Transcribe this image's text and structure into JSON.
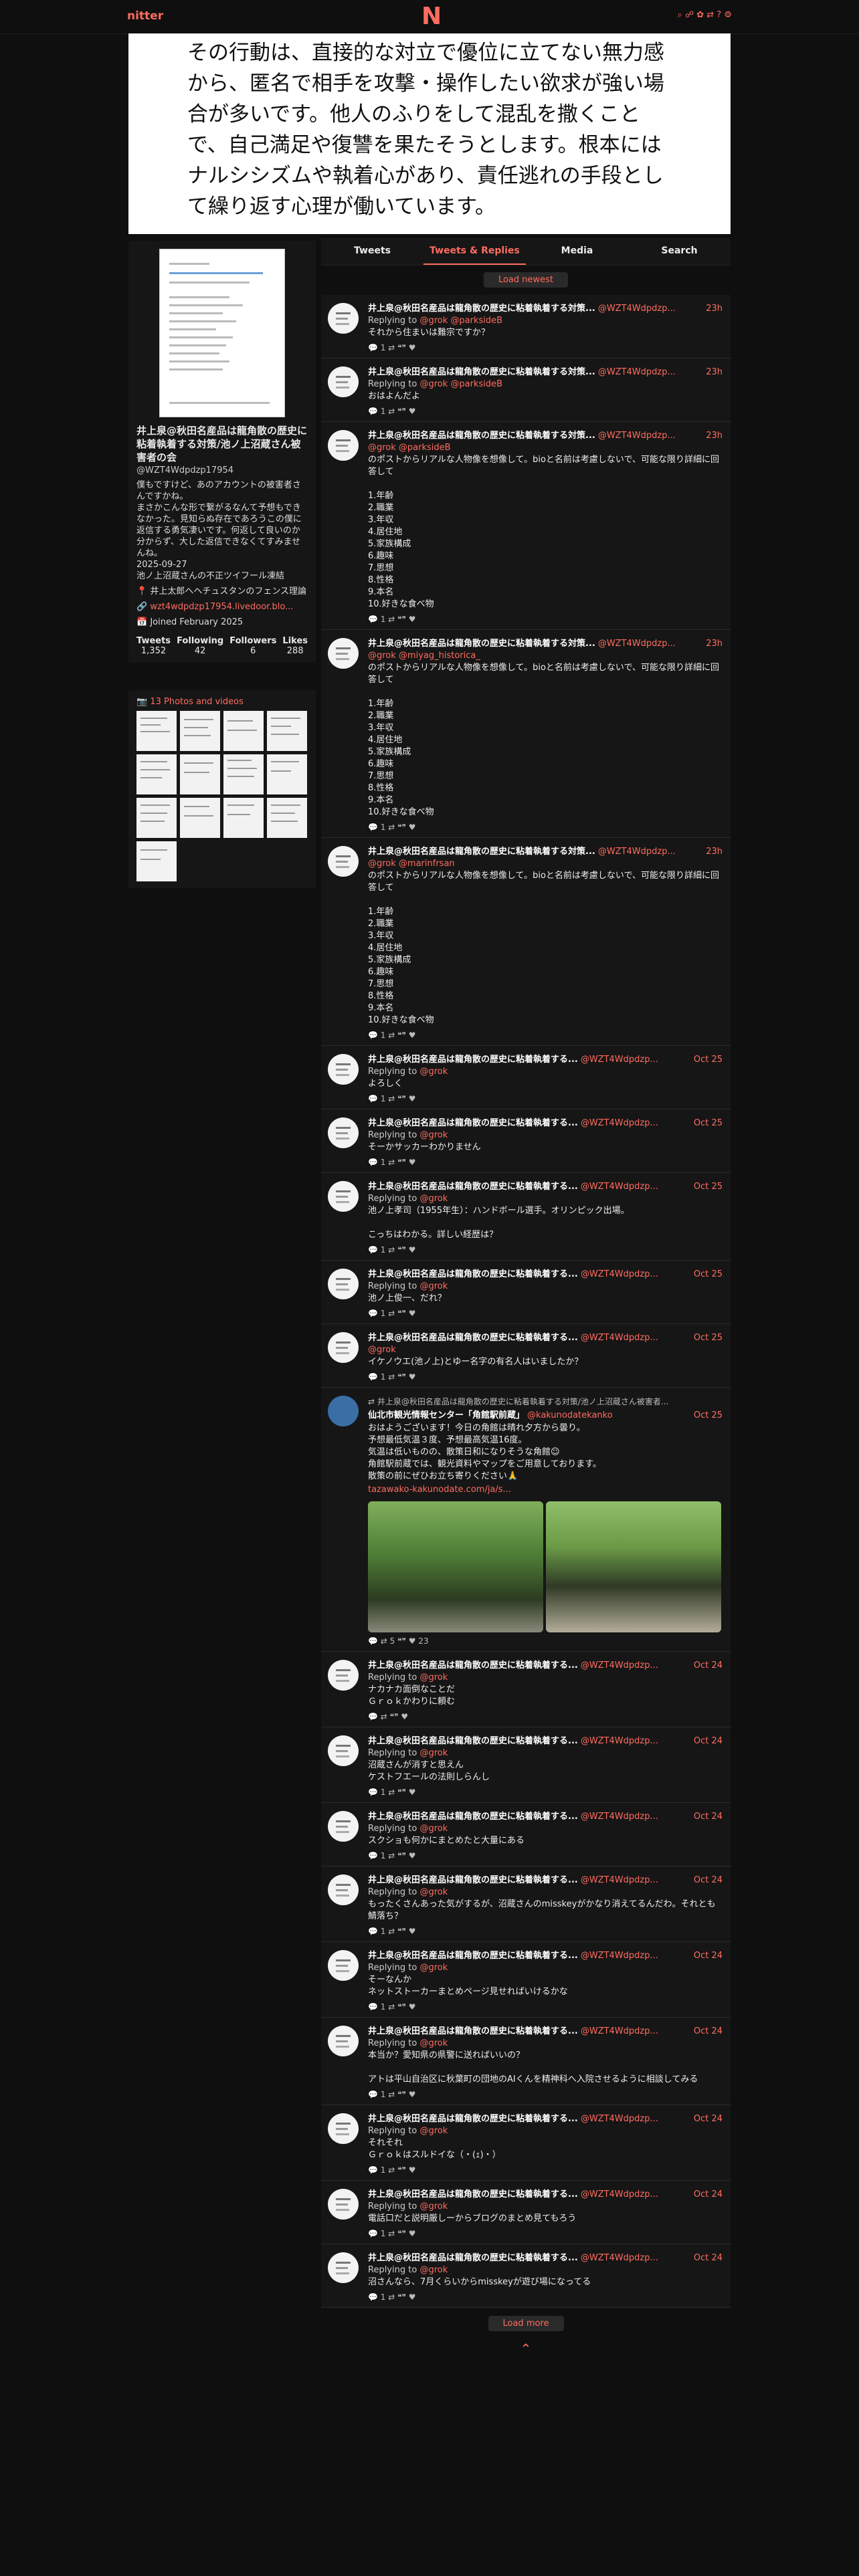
{
  "nav": {
    "brand": "nitter",
    "logo": "N",
    "icons": "⌕ ☍ ✿ ⇄ ? ⚙"
  },
  "hero": {
    "text": "その行動は、直接的な対立で優位に立てない無力感から、匿名で相手を攻撃・操作したい欲求が強い場合が多いです。他人のふりをして混乱を撒くことで、自己満足や復讐を果たそうとします。根本にはナルシシズムや執着心があり、責任逃れの手段として繰り返す心理が働いています。"
  },
  "profile": {
    "name": "井上泉@秋田名産品は龍角散の歴史に粘着執着する対策/池ノ上沼蔵さん被害者の会",
    "handle": "@WZT4Wdpdzp17954",
    "bio": "僕もですけど、あのアカウントの被害者さんですかね。\nまさかこんな形で繋がるなんて予想もできなかった。見知らぬ存在であろうこの僕に返信する勇気凄いです。何返して良いのか分からず、大した返信できなくてすみませんね。\n2025-09-27\n池ノ上沼蔵さんの不正ツイフール凍結",
    "location": "📍 井上太郎ヘヘチュスタンのフェンス理論",
    "website": "🔗 wzt4wdpdzp17954.livedoor.blo...",
    "joined": "📅 Joined February 2025",
    "stats": [
      {
        "label": "Tweets",
        "value": "1,352"
      },
      {
        "label": "Following",
        "value": "42"
      },
      {
        "label": "Followers",
        "value": "6"
      },
      {
        "label": "Likes",
        "value": "288"
      }
    ]
  },
  "photos": {
    "label": "📷 13 Photos and videos"
  },
  "tabs": [
    "Tweets",
    "Tweets & Replies",
    "Media",
    "Search"
  ],
  "load_newest": "Load newest",
  "load_more": "Load more",
  "tweets": [
    {
      "name": "井上泉@秋田名産品は龍角散の歴史に粘着執着する対策...",
      "handle": "@WZT4Wdpdzp...",
      "time": "23h",
      "reply": "Replying to ",
      "mentions": "@grok @parksideB",
      "text": "それから住まいは難宗ですか？",
      "acts": "💬 1   ⇄   ❝❞   ♥"
    },
    {
      "name": "井上泉@秋田名産品は龍角散の歴史に粘着執着する対策...",
      "handle": "@WZT4Wdpdzp...",
      "time": "23h",
      "reply": "Replying to ",
      "mentions": "@grok @parksideB",
      "text": "おはよんだよ",
      "acts": "💬 1   ⇄   ❝❞   ♥"
    },
    {
      "name": "井上泉@秋田名産品は龍角散の歴史に粘着執着する対策...",
      "handle": "@WZT4Wdpdzp...",
      "time": "23h",
      "reply": "",
      "mentions": "@grok @parksideB",
      "text": "のポストからリアルな人物像を想像して。bioと名前は考慮しないで、可能な限り詳細に回答して\n\n1.年齢\n2.職業\n3.年収\n4.居住地\n5.家族構成\n6.趣味\n7.思想\n8.性格\n9.本名\n10.好きな食べ物",
      "acts": "💬 1   ⇄   ❝❞   ♥"
    },
    {
      "name": "井上泉@秋田名産品は龍角散の歴史に粘着執着する対策...",
      "handle": "@WZT4Wdpdzp...",
      "time": "23h",
      "reply": "",
      "mentions": "@grok @miyag_historica_",
      "text": "のポストからリアルな人物像を想像して。bioと名前は考慮しないで、可能な限り詳細に回答して\n\n1.年齢\n2.職業\n3.年収\n4.居住地\n5.家族構成\n6.趣味\n7.思想\n8.性格\n9.本名\n10.好きな食べ物",
      "acts": "💬 1   ⇄   ❝❞   ♥"
    },
    {
      "name": "井上泉@秋田名産品は龍角散の歴史に粘着執着する対策...",
      "handle": "@WZT4Wdpdzp...",
      "time": "23h",
      "reply": "",
      "mentions": "@grok @marinfrsan",
      "text": "のポストからリアルな人物像を想像して。bioと名前は考慮しないで、可能な限り詳細に回答して\n\n1.年齢\n2.職業\n3.年収\n4.居住地\n5.家族構成\n6.趣味\n7.思想\n8.性格\n9.本名\n10.好きな食べ物",
      "acts": "💬 1   ⇄   ❝❞   ♥"
    },
    {
      "name": "井上泉@秋田名産品は龍角散の歴史に粘着執着する...",
      "handle": "@WZT4Wdpdzp...",
      "time": "Oct 25",
      "reply": "Replying to ",
      "mentions": "@grok",
      "text": "よろしく",
      "acts": "💬 1   ⇄   ❝❞   ♥"
    },
    {
      "name": "井上泉@秋田名産品は龍角散の歴史に粘着執着する...",
      "handle": "@WZT4Wdpdzp...",
      "time": "Oct 25",
      "reply": "Replying to ",
      "mentions": "@grok",
      "text": "そーかサッカーわかりません",
      "acts": "💬 1   ⇄   ❝❞   ♥"
    },
    {
      "name": "井上泉@秋田名産品は龍角散の歴史に粘着執着する...",
      "handle": "@WZT4Wdpdzp...",
      "time": "Oct 25",
      "reply": "Replying to ",
      "mentions": "@grok",
      "text": "池ノ上孝司（1955年生）：ハンドボール選手。オリンピック出場。\n\nこっちはわかる。詳しい経歴は？",
      "acts": "💬 1   ⇄   ❝❞   ♥"
    },
    {
      "name": "井上泉@秋田名産品は龍角散の歴史に粘着執着する...",
      "handle": "@WZT4Wdpdzp...",
      "time": "Oct 25",
      "reply": "Replying to ",
      "mentions": "@grok",
      "text": "池ノ上俊一、だれ？",
      "acts": "💬 1   ⇄   ❝❞   ♥"
    },
    {
      "name": "井上泉@秋田名産品は龍角散の歴史に粘着執着する...",
      "handle": "@WZT4Wdpdzp...",
      "time": "Oct 25",
      "reply": "",
      "mentions": "@grok",
      "text": "イケノウエ(池ノ上)とゆー名字の有名人はいましたか？",
      "acts": "💬 1   ⇄   ❝❞   ♥"
    }
  ],
  "retweet": {
    "line": "⇄ 井上泉@秋田名産品は龍角散の歴史に粘着執着する対策/池ノ上沼蔵さん被害者...",
    "name": "仙北市観光情報センター「角館駅前蔵」",
    "handle": "@kakunodatekanko",
    "time": "Oct 25",
    "text": "おはようございます！今日の角館は晴れ夕方から曇り。\n予想最低気温３度、予想最高気温16度。\n気温は低いものの、散策日和になりそうな角館☺\n角館駅前蔵では、観光資料やマップをご用意しております。\n散策の前にぜひお立ち寄りください🙏",
    "link": "tazawako-kakunodate.com/ja/s...",
    "acts": "💬   ⇄ 5   ❝❞   ♥ 23"
  },
  "tweets2": [
    {
      "name": "井上泉@秋田名産品は龍角散の歴史に粘着執着する...",
      "handle": "@WZT4Wdpdzp...",
      "time": "Oct 24",
      "reply": "Replying to ",
      "mentions": "@grok",
      "text": "ナカナカ面倒なことだ\nＧｒｏｋかわりに頼む",
      "acts": "💬   ⇄   ❝❞   ♥"
    },
    {
      "name": "井上泉@秋田名産品は龍角散の歴史に粘着執着する...",
      "handle": "@WZT4Wdpdzp...",
      "time": "Oct 24",
      "reply": "Replying to ",
      "mentions": "@grok",
      "text": "沼蔵さんが消すと思えん\nケストフエールの法則しらんし",
      "acts": "💬 1   ⇄   ❝❞   ♥"
    },
    {
      "name": "井上泉@秋田名産品は龍角散の歴史に粘着執着する...",
      "handle": "@WZT4Wdpdzp...",
      "time": "Oct 24",
      "reply": "Replying to ",
      "mentions": "@grok",
      "text": "スクショも何かにまとめたと大量にある",
      "acts": "💬 1   ⇄   ❝❞   ♥"
    },
    {
      "name": "井上泉@秋田名産品は龍角散の歴史に粘着執着する...",
      "handle": "@WZT4Wdpdzp...",
      "time": "Oct 24",
      "reply": "Replying to ",
      "mentions": "@grok",
      "text": "もったくさんあった気がするが、沼蔵さんのmisskeyがかなり消えてるんだわ。それとも鯖落ち？",
      "acts": "💬 1   ⇄   ❝❞   ♥"
    },
    {
      "name": "井上泉@秋田名産品は龍角散の歴史に粘着執着する...",
      "handle": "@WZT4Wdpdzp...",
      "time": "Oct 24",
      "reply": "Replying to ",
      "mentions": "@grok",
      "text": "そーなんか\nネットストーカーまとめページ見せればいけるかな",
      "acts": "💬 1   ⇄   ❝❞   ♥"
    },
    {
      "name": "井上泉@秋田名産品は龍角散の歴史に粘着執着する...",
      "handle": "@WZT4Wdpdzp...",
      "time": "Oct 24",
      "reply": "Replying to ",
      "mentions": "@grok",
      "text": "本当か？愛知県の県警に送ればいいの？\n\nアトは平山自治区に秋葉町の団地のAIくんを精神科へ入院させるように相談してみる",
      "acts": "💬 1   ⇄   ❝❞   ♥"
    },
    {
      "name": "井上泉@秋田名産品は龍角散の歴史に粘着執着する...",
      "handle": "@WZT4Wdpdzp...",
      "time": "Oct 24",
      "reply": "Replying to ",
      "mentions": "@grok",
      "text": "それそれ\nＧｒｏｋはスルドイな（・(ｪ)・）",
      "acts": "💬 1   ⇄   ❝❞   ♥"
    },
    {
      "name": "井上泉@秋田名産品は龍角散の歴史に粘着執着する...",
      "handle": "@WZT4Wdpdzp...",
      "time": "Oct 24",
      "reply": "Replying to ",
      "mentions": "@grok",
      "text": "電話口だと説明厳しーからブログのまとめ見てもろう",
      "acts": "💬 1   ⇄   ❝❞   ♥"
    },
    {
      "name": "井上泉@秋田名産品は龍角散の歴史に粘着執着する...",
      "handle": "@WZT4Wdpdzp...",
      "time": "Oct 24",
      "reply": "Replying to ",
      "mentions": "@grok",
      "text": "沼さんなら、7月くらいからmisskeyが遊び場になってる",
      "acts": "💬 1   ⇄   ❝❞   ♥"
    }
  ]
}
